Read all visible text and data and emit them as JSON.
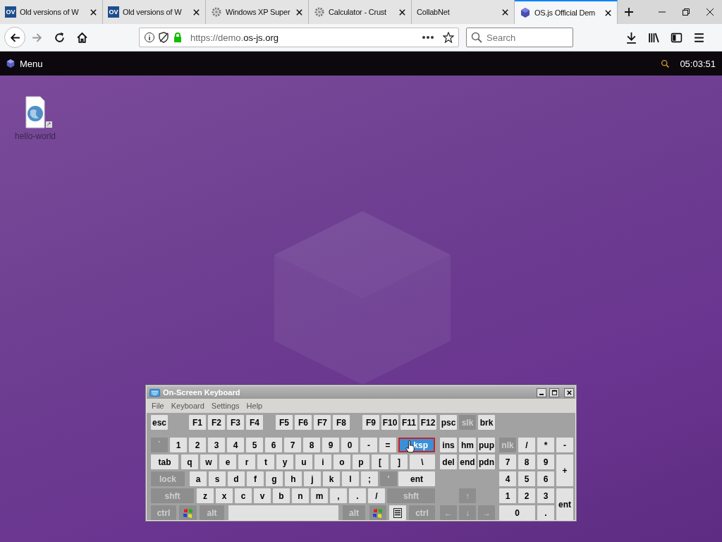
{
  "browser": {
    "tabs": [
      {
        "title": "Old versions of W",
        "kind": "letters",
        "favicon_text": "OV",
        "selected": false
      },
      {
        "title": "Old versions of W",
        "kind": "letters",
        "favicon_text": "OV",
        "selected": false
      },
      {
        "title": "Windows XP Super",
        "kind": "gear",
        "selected": false
      },
      {
        "title": "Calculator - Crust",
        "kind": "gear",
        "selected": false
      },
      {
        "title": "CollabNet",
        "kind": "plain",
        "selected": false
      },
      {
        "title": "OS.js Official Dem",
        "kind": "cube",
        "selected": true
      }
    ],
    "navigation": {
      "back_enabled": true,
      "forward_enabled": false
    },
    "address_bar": {
      "scheme": "https://demo.",
      "host": "os-js.org"
    },
    "search": {
      "placeholder": "Search"
    }
  },
  "os_panel": {
    "menu_label": "Menu",
    "clock": "05:03:51"
  },
  "desktop_icons": [
    {
      "label": "hello-world"
    }
  ],
  "keyboard_window": {
    "title": "On-Screen Keyboard",
    "menu": [
      "File",
      "Keyboard",
      "Settings",
      "Help"
    ],
    "key_lines": [
      [
        {
          "label": "esc",
          "kind": "key",
          "pressed": false
        },
        {
          "label": "F1",
          "kind": "key",
          "pressed": false
        },
        {
          "label": "F2",
          "kind": "key",
          "pressed": false
        },
        {
          "label": "F3",
          "kind": "key",
          "pressed": false
        },
        {
          "label": "F4",
          "kind": "key",
          "pressed": false
        },
        {
          "label": "F5",
          "kind": "key",
          "pressed": false
        },
        {
          "label": "F6",
          "kind": "key",
          "pressed": false
        },
        {
          "label": "F7",
          "kind": "key",
          "pressed": false
        },
        {
          "label": "F8",
          "kind": "key",
          "pressed": false
        },
        {
          "label": "F9",
          "kind": "key",
          "pressed": false
        },
        {
          "label": "F10",
          "kind": "key",
          "pressed": false
        },
        {
          "label": "F11",
          "kind": "key",
          "pressed": false
        },
        {
          "label": "F12",
          "kind": "key",
          "pressed": false
        },
        {
          "label": "psc",
          "kind": "key",
          "pressed": false
        },
        {
          "label": "slk",
          "kind": "modifier",
          "pressed": false
        },
        {
          "label": "brk",
          "kind": "key",
          "pressed": false
        }
      ],
      [
        {
          "label": "`",
          "kind": "modifier",
          "pressed": false
        },
        {
          "label": "1",
          "kind": "key",
          "pressed": false
        },
        {
          "label": "2",
          "kind": "key",
          "pressed": false
        },
        {
          "label": "3",
          "kind": "key",
          "pressed": false
        },
        {
          "label": "4",
          "kind": "key",
          "pressed": false
        },
        {
          "label": "5",
          "kind": "key",
          "pressed": false
        },
        {
          "label": "6",
          "kind": "key",
          "pressed": false
        },
        {
          "label": "7",
          "kind": "key",
          "pressed": false
        },
        {
          "label": "8",
          "kind": "key",
          "pressed": false
        },
        {
          "label": "9",
          "kind": "key",
          "pressed": false
        },
        {
          "label": "0",
          "kind": "key",
          "pressed": false
        },
        {
          "label": "-",
          "kind": "key",
          "pressed": false
        },
        {
          "label": "=",
          "kind": "key",
          "pressed": false
        },
        {
          "label": "ksp",
          "kind": "key",
          "pressed": true
        },
        {
          "label": "ins",
          "kind": "key",
          "pressed": false
        },
        {
          "label": "hm",
          "kind": "key",
          "pressed": false
        },
        {
          "label": "pup",
          "kind": "key",
          "pressed": false
        },
        {
          "label": "nlk",
          "kind": "modifier",
          "pressed": false
        },
        {
          "label": "/",
          "kind": "key",
          "pressed": false
        },
        {
          "label": "*",
          "kind": "key",
          "pressed": false
        },
        {
          "label": "-",
          "kind": "key",
          "pressed": false
        }
      ],
      [
        {
          "label": "tab",
          "kind": "key",
          "pressed": false
        },
        {
          "label": "q",
          "kind": "key",
          "pressed": false
        },
        {
          "label": "w",
          "kind": "key",
          "pressed": false
        },
        {
          "label": "e",
          "kind": "key",
          "pressed": false
        },
        {
          "label": "r",
          "kind": "key",
          "pressed": false
        },
        {
          "label": "t",
          "kind": "key",
          "pressed": false
        },
        {
          "label": "y",
          "kind": "key",
          "pressed": false
        },
        {
          "label": "u",
          "kind": "key",
          "pressed": false
        },
        {
          "label": "i",
          "kind": "key",
          "pressed": false
        },
        {
          "label": "o",
          "kind": "key",
          "pressed": false
        },
        {
          "label": "p",
          "kind": "key",
          "pressed": false
        },
        {
          "label": "[",
          "kind": "key",
          "pressed": false
        },
        {
          "label": "]",
          "kind": "key",
          "pressed": false
        },
        {
          "label": "\\",
          "kind": "key",
          "pressed": false
        },
        {
          "label": "del",
          "kind": "key",
          "pressed": false
        },
        {
          "label": "end",
          "kind": "key",
          "pressed": false
        },
        {
          "label": "pdn",
          "kind": "key",
          "pressed": false
        },
        {
          "label": "7",
          "kind": "key",
          "pressed": false
        },
        {
          "label": "8",
          "kind": "key",
          "pressed": false
        },
        {
          "label": "9",
          "kind": "key",
          "pressed": false
        },
        {
          "label": "+",
          "kind": "key",
          "pressed": false
        }
      ],
      [
        {
          "label": "lock",
          "kind": "modifier",
          "pressed": false
        },
        {
          "label": "a",
          "kind": "key",
          "pressed": false
        },
        {
          "label": "s",
          "kind": "key",
          "pressed": false
        },
        {
          "label": "d",
          "kind": "key",
          "pressed": false
        },
        {
          "label": "f",
          "kind": "key",
          "pressed": false
        },
        {
          "label": "g",
          "kind": "key",
          "pressed": false
        },
        {
          "label": "h",
          "kind": "key",
          "pressed": false
        },
        {
          "label": "j",
          "kind": "key",
          "pressed": false
        },
        {
          "label": "k",
          "kind": "key",
          "pressed": false
        },
        {
          "label": "l",
          "kind": "key",
          "pressed": false
        },
        {
          "label": ";",
          "kind": "key",
          "pressed": false
        },
        {
          "label": "'",
          "kind": "modifier",
          "pressed": false
        },
        {
          "label": "ent",
          "kind": "key",
          "pressed": false
        },
        {
          "label": "4",
          "kind": "key",
          "pressed": false
        },
        {
          "label": "5",
          "kind": "key",
          "pressed": false
        },
        {
          "label": "6",
          "kind": "key",
          "pressed": false
        }
      ],
      [
        {
          "label": "shft",
          "kind": "modifier",
          "pressed": false
        },
        {
          "label": "z",
          "kind": "key",
          "pressed": false
        },
        {
          "label": "x",
          "kind": "key",
          "pressed": false
        },
        {
          "label": "c",
          "kind": "key",
          "pressed": false
        },
        {
          "label": "v",
          "kind": "key",
          "pressed": false
        },
        {
          "label": "b",
          "kind": "key",
          "pressed": false
        },
        {
          "label": "n",
          "kind": "key",
          "pressed": false
        },
        {
          "label": "m",
          "kind": "key",
          "pressed": false
        },
        {
          "label": ",",
          "kind": "key",
          "pressed": false
        },
        {
          "label": ".",
          "kind": "key",
          "pressed": false
        },
        {
          "label": "/",
          "kind": "key",
          "pressed": false
        },
        {
          "label": "shft",
          "kind": "modifier",
          "pressed": false
        },
        {
          "label": "↑",
          "kind": "modifier",
          "pressed": false
        },
        {
          "label": "1",
          "kind": "key",
          "pressed": false
        },
        {
          "label": "2",
          "kind": "key",
          "pressed": false
        },
        {
          "label": "3",
          "kind": "key",
          "pressed": false
        },
        {
          "label": "ent",
          "kind": "key",
          "pressed": false
        }
      ],
      [
        {
          "label": "ctrl",
          "kind": "modifier",
          "pressed": false
        },
        {
          "kind": "windows",
          "pressed": false
        },
        {
          "label": "alt",
          "kind": "modifier",
          "pressed": false
        },
        {
          "kind": "space",
          "pressed": false
        },
        {
          "label": "alt",
          "kind": "modifier",
          "pressed": false
        },
        {
          "kind": "windows",
          "pressed": false
        },
        {
          "kind": "menu",
          "pressed": false
        },
        {
          "label": "ctrl",
          "kind": "modifier",
          "pressed": false
        },
        {
          "label": "←",
          "kind": "modifier",
          "pressed": false
        },
        {
          "label": "↓",
          "kind": "modifier",
          "pressed": false
        },
        {
          "label": "→",
          "kind": "modifier",
          "pressed": false
        },
        {
          "label": "0",
          "kind": "key",
          "pressed": false
        },
        {
          "label": ".",
          "kind": "key",
          "pressed": false
        }
      ]
    ]
  }
}
